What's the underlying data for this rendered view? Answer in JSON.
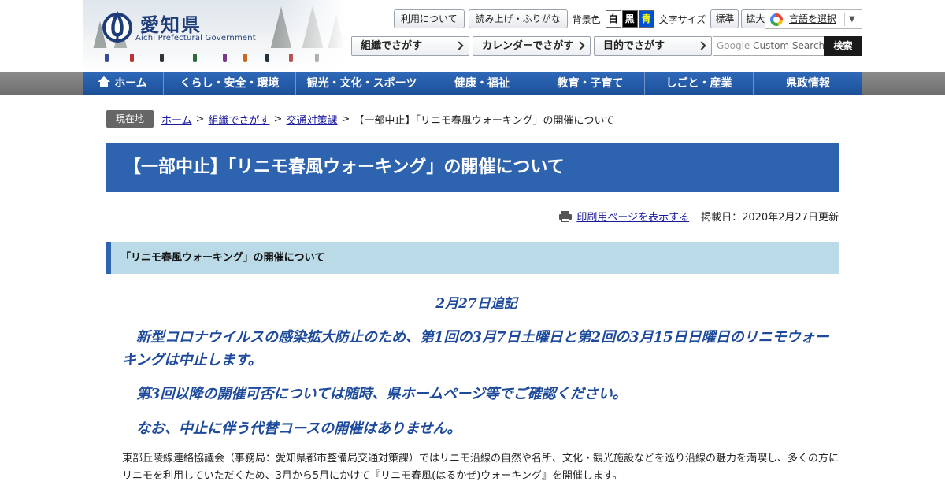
{
  "header": {
    "logo_title": "愛知県",
    "logo_subtitle": "Aichi Prefectural Government",
    "tools": {
      "usage_label": "利用について",
      "read_aloud_label": "読み上げ・ふりがな",
      "bg_color_label": "背景色",
      "bg_white": "白",
      "bg_black": "黒",
      "bg_blue": "青",
      "font_size_label": "文字サイズ",
      "font_normal": "標準",
      "font_large": "拡大"
    },
    "language": {
      "label": "言語を選択",
      "arrow": "▼"
    },
    "search_nav": [
      {
        "label": "組織でさがす"
      },
      {
        "label": "カレンダーでさがす"
      },
      {
        "label": "目的でさがす"
      }
    ],
    "search": {
      "placeholder_brand": "Google",
      "placeholder_text": " Custom Search",
      "button_label": "検索"
    }
  },
  "global_nav": [
    {
      "label": "ホーム"
    },
    {
      "label": "くらし・安全・環境"
    },
    {
      "label": "観光・文化・スポーツ"
    },
    {
      "label": "健康・福祉"
    },
    {
      "label": "教育・子育て"
    },
    {
      "label": "しごと・産業"
    },
    {
      "label": "県政情報"
    }
  ],
  "breadcrumb": {
    "badge": "現在地",
    "items": [
      {
        "label": "ホーム"
      },
      {
        "label": "組織でさがす"
      },
      {
        "label": "交通対策課"
      }
    ],
    "separator": ">",
    "current": "【一部中止】「リニモ春風ウォーキング」の開催について"
  },
  "page": {
    "title": "【一部中止】「リニモ春風ウォーキング」の開催について",
    "print_link": "印刷用ページを表示する",
    "published": "掲載日：2020年2月27日更新",
    "section_heading": "「リニモ春風ウォーキング」の開催について",
    "notice_date": "2月27日追記",
    "notice_1": "新型コロナウイルスの感染拡大防止のため、第1回の3月7日土曜日と第2回の3月15日日曜日のリニモウォーキングは中止します。",
    "notice_2": "第3回以降の開催可否については随時、県ホームページ等でご確認ください。",
    "notice_3": "なお、中止に伴う代替コースの開催はありません。",
    "body": "東部丘陵線連絡協議会（事務局：愛知県都市整備局交通対策課）ではリニモ沿線の自然や名所、文化・観光施設などを巡り沿線の魅力を満喫し、多くの方にリニモを利用していただくため、3月から5月にかけて『リニモ春風(はるかぜ)ウォーキング』を開催します。"
  },
  "colors": {
    "brand_blue": "#2e63b0",
    "nav_blue": "#1c4f9a",
    "section_bg": "#b9dae6",
    "notice_text": "#1d4a9b",
    "link": "#1a1aa0"
  },
  "icons": {
    "home": "home-icon",
    "print": "printer-icon",
    "chevron": "chevron-right-icon",
    "google": "google-g-icon"
  }
}
